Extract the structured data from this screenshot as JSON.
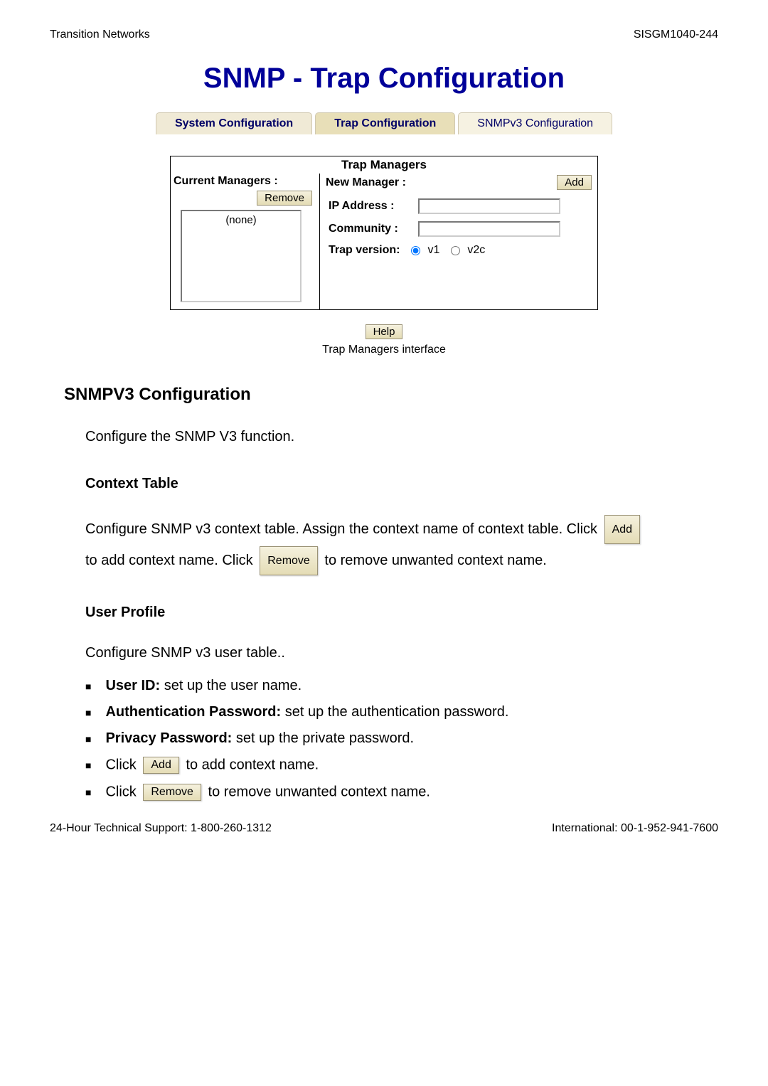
{
  "header": {
    "left": "Transition Networks",
    "right": "SISGM1040-244"
  },
  "page_title": "SNMP - Trap Configuration",
  "tabs": {
    "system": "System Configuration",
    "trap": "Trap Configuration",
    "snmpv3": "SNMPv3 Configuration"
  },
  "panel": {
    "title": "Trap Managers",
    "col_left_header": "Current Managers :",
    "col_right_header": "New Manager :",
    "remove_btn": "Remove",
    "add_btn": "Add",
    "list_placeholder": "(none)",
    "ip_label": "IP Address :",
    "community_label": "Community :",
    "trap_version_label": "Trap version:",
    "trap_v1_label": "v1",
    "trap_v2c_label": "v2c",
    "trap_version_selected": "v1"
  },
  "help_btn": "Help",
  "caption": "Trap Managers interface",
  "section": {
    "title": "SNMPV3 Configuration",
    "intro": "Configure the SNMP V3 function.",
    "context_title": "Context Table",
    "context_text_1": "Configure SNMP v3 context table. Assign the context name of context table. Click",
    "context_add_btn": "Add",
    "context_text_2": "to add context name. Click",
    "context_remove_btn": "Remove",
    "context_text_3": "to remove unwanted context name.",
    "user_profile_title": "User Profile",
    "user_profile_intro": "Configure SNMP v3 user table..",
    "bullets": [
      {
        "bold": "User ID:",
        "rest": " set up the user name."
      },
      {
        "bold": "Authentication Password:",
        "rest": " set up the authentication password."
      },
      {
        "bold": "Privacy Password:",
        "rest": " set up the private password."
      }
    ],
    "bullet_click_add_pre": "Click",
    "bullet_click_add_btn": "Add",
    "bullet_click_add_post": "to add context name.",
    "bullet_click_remove_pre": "Click",
    "bullet_click_remove_btn": "Remove",
    "bullet_click_remove_post": "to remove unwanted context name."
  },
  "footer": {
    "left": "24-Hour Technical Support: 1-800-260-1312",
    "right": "International: 00-1-952-941-7600"
  }
}
